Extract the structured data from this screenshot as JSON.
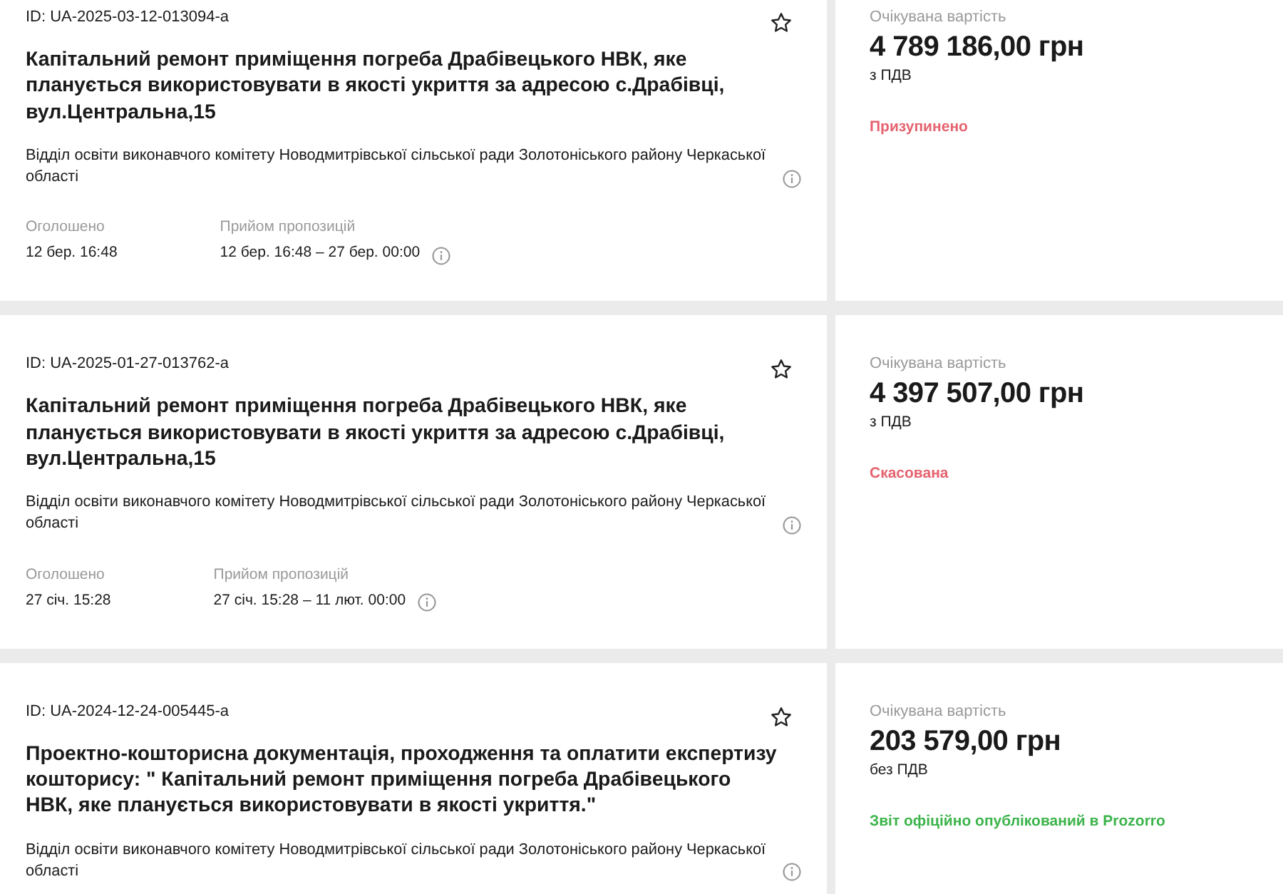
{
  "tenders": [
    {
      "id": "ID: UA-2025-03-12-013094-a",
      "title": "Капітальний ремонт приміщення погреба Драбівецького НВК, яке планується використовувати в якості укриття за адресою с.Драбівці, вул.Центральна,15",
      "organization": "Відділ освіти виконавчого комітету Новодмитрівської сільської ради Золотоніського району Черкаської області",
      "dates": [
        {
          "label": "Оголошено",
          "value": "12 бер. 16:48"
        },
        {
          "label": "Прийом пропозицій",
          "value": "12 бер. 16:48 – 27 бер. 00:00"
        }
      ],
      "value_label": "Очікувана вартість",
      "amount": "4 789 186,00 грн",
      "vat": "з ПДВ",
      "status": {
        "text": "Призупинено",
        "color": "#e5636f"
      }
    },
    {
      "id": "ID: UA-2025-01-27-013762-a",
      "title": "Капітальний ремонт приміщення погреба Драбівецького НВК, яке планується використовувати в якості укриття за адресою с.Драбівці, вул.Центральна,15",
      "organization": "Відділ освіти виконавчого комітету Новодмитрівської сільської ради Золотоніського району Черкаської області",
      "dates": [
        {
          "label": "Оголошено",
          "value": "27 січ. 15:28"
        },
        {
          "label": "Прийом пропозицій",
          "value": "27 січ. 15:28 – 11 лют. 00:00"
        }
      ],
      "value_label": "Очікувана вартість",
      "amount": "4 397 507,00 грн",
      "vat": "з ПДВ",
      "status": {
        "text": "Скасована",
        "color": "#e5636f"
      }
    },
    {
      "id": "ID: UA-2024-12-24-005445-a",
      "title": "Проектно-кошторисна документація, проходження та оплатити експертизу кошторису: \" Капітальний ремонт приміщення погреба Драбівецького НВК, яке планується використовувати в якості укриття.\"",
      "organization": "Відділ освіти виконавчого комітету Новодмитрівської сільської ради Золотоніського району Черкаської області",
      "value_label": "Очікувана вартість",
      "amount": "203 579,00 грн",
      "vat": "без ПДВ",
      "status": {
        "text": "Звіт офіційно опублікований в Prozorro",
        "color": "#3cb44b"
      }
    }
  ]
}
